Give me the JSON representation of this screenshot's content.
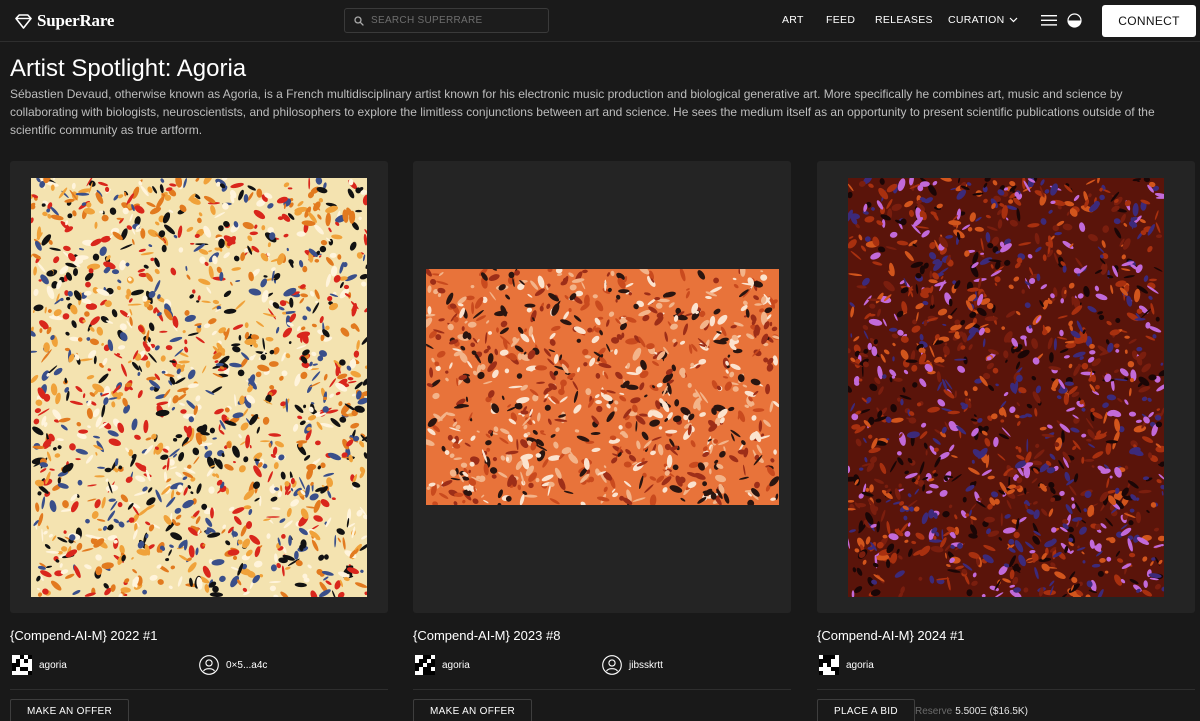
{
  "header": {
    "logo_text": "SuperRare",
    "search_placeholder": "SEARCH SUPERRARE",
    "nav": [
      "ART",
      "FEED",
      "RELEASES",
      "CURATION"
    ],
    "connect_label": "CONNECT"
  },
  "intro": {
    "title": "Artist Spotlight: Agoria",
    "description": "Sébastien Devaud, otherwise known as Agoria, is a French multidisciplinary artist known for his electronic music production and biological generative art. More specifically he combines art, music and science by collaborating with biologists, neuroscientists, and philosophers to explore the limitless conjunctions between art and science. He sees the medium itself as an opportunity to present scientific publications outside of the scientific community as true artform."
  },
  "cards": [
    {
      "title": "{Compend-AI-M} 2022 #1",
      "creator": "agoria",
      "owner": "0×5...a4c",
      "action_label": "MAKE AN OFFER",
      "palette": [
        "#f4e3b0",
        "#f0a23a",
        "#e27a1f",
        "#121212",
        "#d9261c",
        "#3a4f8a",
        "#fff4dc"
      ]
    },
    {
      "title": "{Compend-AI-M} 2023 #8",
      "creator": "agoria",
      "owner": "jibsskrtt",
      "action_label": "MAKE AN OFFER",
      "palette": [
        "#e8733a",
        "#f3b48a",
        "#c94a1e",
        "#2a1510",
        "#fbe3cf",
        "#9d2e18"
      ]
    },
    {
      "title": "{Compend-AI-M} 2024 #1",
      "creator": "agoria",
      "action_label": "PLACE A BID",
      "reserve_label": "Reserve",
      "reserve_value": "5.500Ξ ($16.5K)",
      "palette": [
        "#5a140a",
        "#a8300f",
        "#d2551c",
        "#1a0606",
        "#c26ad9",
        "#3c2a7a",
        "#7a1e0e"
      ]
    }
  ]
}
